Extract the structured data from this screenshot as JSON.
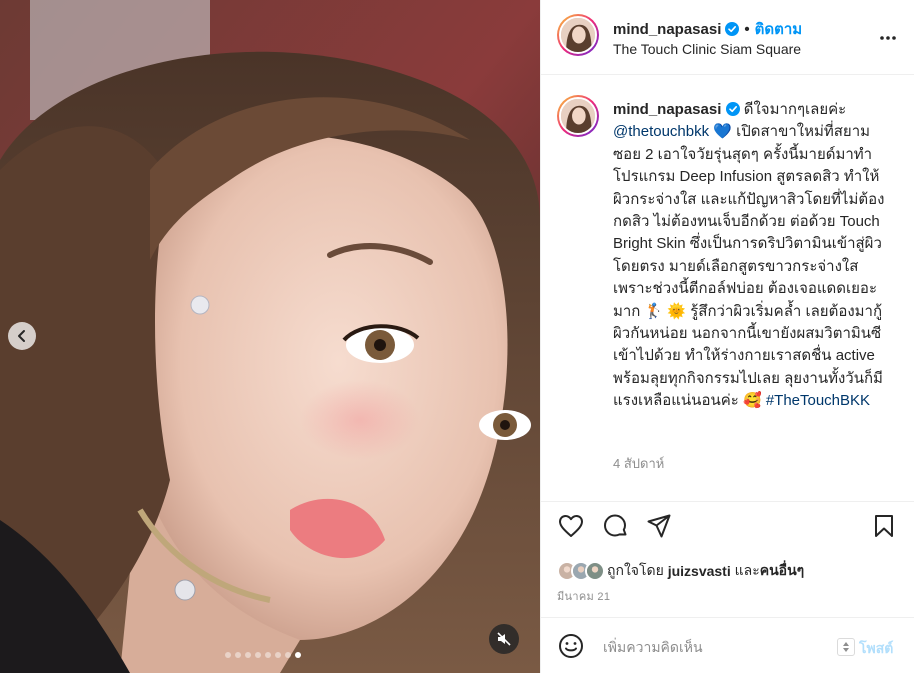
{
  "post": {
    "username": "mind_napasasi",
    "follow_label": "ติดตาม",
    "separator": "•",
    "location": "The Touch Clinic Siam Square",
    "caption_prefix": "ดีใจมากๆเลยค่ะ",
    "caption_mention": "@thetouchbkk",
    "caption_body": " 💙 เปิดสาขาใหม่ที่สยามซอย 2 เอาใจวัยรุ่นสุดๆ ครั้งนี้มายด์มาทำโปรแกรม Deep Infusion สูตรลดสิว ทำให้ผิวกระจ่างใส และแก้ปัญหาสิวโดยที่ไม่ต้องกดสิว ไม่ต้องทนเจ็บอีกด้วย ต่อด้วย Touch Bright Skin ซึ่งเป็นการดริปวิตามินเข้าสู่ผิวโดยตรง มายด์เลือกสูตรขาวกระจ่างใส เพราะช่วงนี้ตีกอล์ฟบ่อย ต้องเจอแดดเยอะมาก 🏌️ 🌞 รู้สึกว่าผิวเริ่มคล้ำ เลยต้องมากู้ผิวกันหน่อย นอกจากนี้เขายังผสมวิตามินซีเข้าไปด้วย ทำให้ร่างกายเราสดชื่น active พร้อมลุยทุกกิจกรรมไปเลย ลุยงานทั้งวันก็มีแรงเหลือแน่นอนค่ะ 🥰",
    "caption_hashtag": "#TheTouchBKK",
    "time_ago": "4 สัปดาห์",
    "likes_prefix": "ถูกใจโดย",
    "likes_user": "juizsvasti",
    "likes_mid": "และ",
    "likes_others": "คนอื่นๆ",
    "date": "มีนาคม 21",
    "comment_placeholder": "เพิ่มความคิดเห็น",
    "post_label": "โพสต์"
  },
  "carousel": {
    "dot_count": 8,
    "active_dot": 7
  },
  "icons": {
    "verified": "verified-badge-icon",
    "more": "more-options-icon",
    "like": "heart-icon",
    "comment": "comment-icon",
    "share": "paper-plane-icon",
    "save": "bookmark-icon",
    "emoji": "smiley-icon",
    "prev": "chevron-left-icon",
    "mute": "speaker-muted-icon"
  },
  "colors": {
    "accent": "#0095f6",
    "text": "#262626",
    "muted": "#8e8e8e",
    "link": "#00376b",
    "verified": "#0095f6"
  }
}
